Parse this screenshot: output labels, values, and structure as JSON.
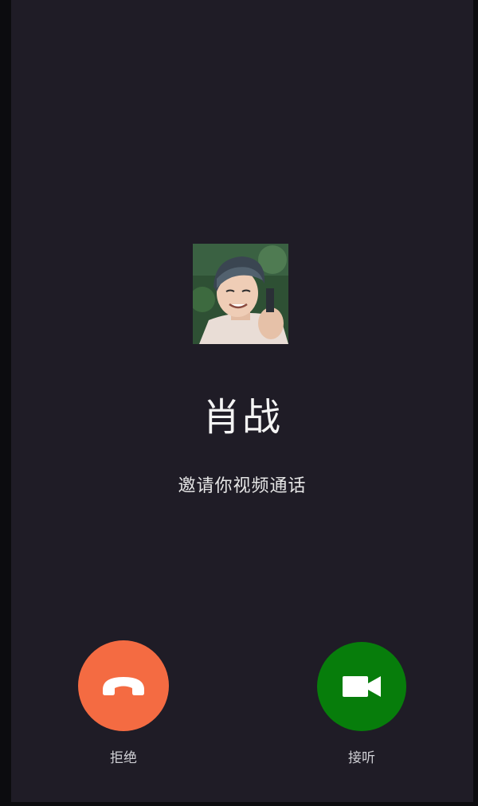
{
  "caller": {
    "name": "肖战",
    "status": "邀请你视频通话",
    "avatar_icon": "caller-avatar-photo"
  },
  "actions": {
    "decline": {
      "label": "拒绝",
      "icon": "phone-hangup-icon",
      "color": "#f46b42"
    },
    "accept": {
      "label": "接听",
      "icon": "video-camera-icon",
      "color": "#077d0b"
    }
  },
  "colors": {
    "background": "#1f1c26",
    "text": "#ffffff"
  }
}
